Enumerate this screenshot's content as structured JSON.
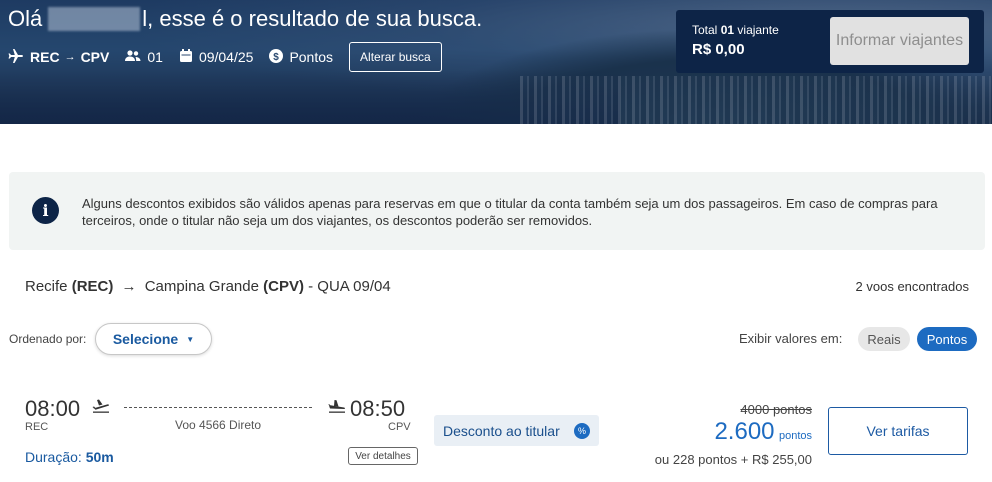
{
  "header": {
    "greeting_prefix": "Olá",
    "greeting_suffix": "l, esse é o resultado de sua busca.",
    "origin": "REC",
    "arrow": "→",
    "destination": "CPV",
    "passengers": "01",
    "date": "09/04/25",
    "currency_mode": "Pontos",
    "alter_button": "Alterar busca"
  },
  "travel_box": {
    "total_label_prefix": "Total",
    "total_count": "01",
    "total_label_suffix": "viajante",
    "amount": "R$ 0,00",
    "inform_button": "Informar viajantes"
  },
  "notice": {
    "text": "Alguns descontos exibidos são válidos apenas para reservas em que o titular da conta também seja um dos passageiros. Em caso de compras para terceiros, onde o titular não seja um dos viajantes, os descontos poderão ser removidos."
  },
  "route": {
    "origin_city": "Recife",
    "origin_code": "(REC)",
    "arrow": "→",
    "destination_city": "Campina Grande",
    "destination_code": "(CPV)",
    "date_suffix": "- QUA 09/04",
    "found": "2 voos encontrados"
  },
  "sort": {
    "label": "Ordenado por:",
    "selected": "Selecione"
  },
  "view": {
    "label": "Exibir valores em:",
    "option_reais": "Reais",
    "option_pontos": "Pontos"
  },
  "flight": {
    "departure_time": "08:00",
    "arrival_time": "08:50",
    "departure_code": "REC",
    "arrival_code": "CPV",
    "info": "Voo 4566 Direto",
    "duration_label": "Duração:",
    "duration_value": "50m",
    "details_button": "Ver detalhes",
    "discount_label": "Desconto ao titular",
    "discount_badge": "%",
    "old_price": "4000 pontos",
    "new_price": "2.600",
    "new_price_unit": "pontos",
    "combo_price": "ou 228 pontos + R$ 255,00",
    "fares_button": "Ver tarifas"
  },
  "colors": {
    "brand_dark": "#0d2447",
    "accent_blue": "#1d6bc1",
    "link_blue": "#1a5aa0"
  },
  "icons": [
    "plane-icon",
    "passengers-icon",
    "calendar-icon",
    "points-icon",
    "info-icon",
    "departure-icon",
    "arrival-icon",
    "discount-icon",
    "chevron-down-icon"
  ]
}
